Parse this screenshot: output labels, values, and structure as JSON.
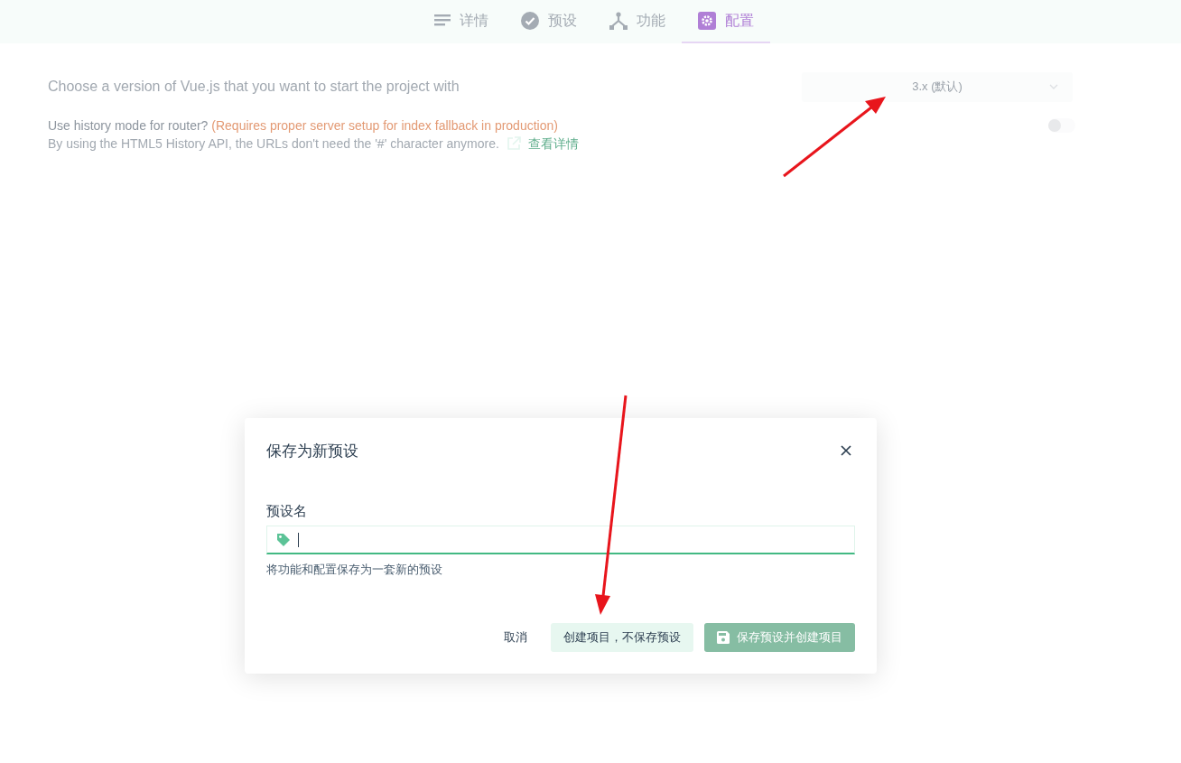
{
  "tabs": [
    {
      "label": "详情",
      "selected": false
    },
    {
      "label": "预设",
      "selected": false
    },
    {
      "label": "功能",
      "selected": false
    },
    {
      "label": "配置",
      "selected": true
    }
  ],
  "settings": [
    {
      "kind": "select",
      "label": "Choose a version of Vue.js that you want to start the project with",
      "value": "3.x (默认)"
    },
    {
      "kind": "toggle",
      "label": "Use history mode for router?",
      "warning": "(Requires proper server setup for index fallback in production)",
      "description": "By using the HTML5 History API, the URLs don't need the '#' character anymore.",
      "link": "查看详情",
      "on": false
    }
  ],
  "dialog": {
    "title": "保存为新预设",
    "field_label": "预设名",
    "help": "将功能和配置保存为一套新的预设",
    "buttons": [
      {
        "kind": "flat",
        "label": "取消",
        "disabled": false
      },
      {
        "kind": "secondary",
        "label": "创建项目，不保存预设",
        "disabled": false
      },
      {
        "kind": "primary",
        "label": "保存预设并创建项目",
        "disabled": true
      }
    ]
  }
}
